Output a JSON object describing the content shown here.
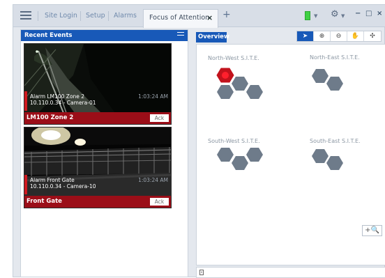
{
  "tabs": {
    "menu": "menu-icon",
    "site_login": "Site Login",
    "setup": "Setup",
    "alarms": "Alarms",
    "focus": "Focus of Attention",
    "close_icon": "×",
    "add_icon": "+"
  },
  "titlebar": {
    "status_color": "#3fd043",
    "gear_icon": "⚙",
    "minimize": "−",
    "maximize": "□",
    "close": "×"
  },
  "recent_events": {
    "title": "Recent Events",
    "events": [
      {
        "alarm_name": "Alarm LM100 Zone 2",
        "ip_camera": "10.110.0.34 - Camera-01",
        "time": "1:03:24 AM",
        "title": "LM100 Zone 2",
        "ack": "Ack"
      },
      {
        "alarm_name": "Alarm Front Gate",
        "ip_camera": "10.110.0.34 - Camera-10",
        "time": "1:03:24 AM",
        "title": "Front Gate",
        "ack": "Ack"
      }
    ]
  },
  "overview": {
    "tab_label": "Overview",
    "sites": [
      {
        "label": "North-West S.I.T.E."
      },
      {
        "label": "North-East S.I.T.E."
      },
      {
        "label": "South-West S.I.T.E."
      },
      {
        "label": "South-East S.I.T.E."
      }
    ],
    "alert_color": "#c2121c",
    "hex_color": "#6e7b8a",
    "map_controls_icon": "+🔍"
  },
  "toolbar": {
    "tools": [
      "pointer-icon",
      "zoom-in-icon",
      "zoom-out-icon",
      "pan-hand-icon",
      "select-icon"
    ]
  }
}
